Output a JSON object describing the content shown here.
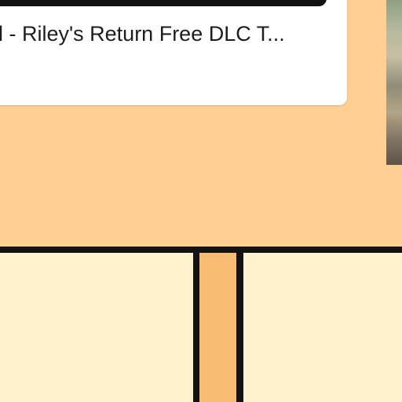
{
  "card": {
    "title": "l - Riley's Return Free DLC T..."
  },
  "thumbnail": {
    "label": "game-thumbnail"
  },
  "colors": {
    "background": "#ffcf94",
    "bottom_panel": "#fff2cf",
    "border": "#121212",
    "accent_strip": "#f8bd72",
    "card_bg": "#ffffff"
  }
}
